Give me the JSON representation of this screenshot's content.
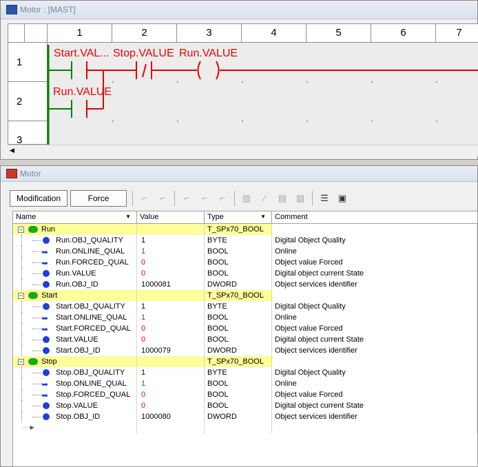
{
  "ladder": {
    "title": "Motor : [MAST]",
    "columns": [
      "1",
      "2",
      "3",
      "4",
      "5",
      "6",
      "7"
    ],
    "rows": [
      "1",
      "2",
      "3"
    ],
    "labels": {
      "start": "Start.VAL...",
      "stop": "Stop.VALUE",
      "run_coil": "Run.VALUE",
      "run_seal": "Run.VALUE"
    }
  },
  "varwin": {
    "title": "Motor",
    "toolbar": {
      "modification": "Modification",
      "force": "Force"
    },
    "headers": {
      "name": "Name",
      "value": "Value",
      "type": "Type",
      "comment": "Comment"
    },
    "groups": [
      {
        "name": "Run",
        "type": "T_SPx70_BOOL",
        "items": [
          {
            "name": "Run.OBJ_QUALITY",
            "value": "1",
            "type": "BYTE",
            "comment": "Digital Object Quality",
            "icon": "dot",
            "vcolor": "black"
          },
          {
            "name": "Run.ONLINE_QUAL",
            "value": "1",
            "type": "BOOL",
            "comment": "Online",
            "icon": "arrow",
            "vcolor": "green"
          },
          {
            "name": "Run.FORCED_QUAL",
            "value": "0",
            "type": "BOOL",
            "comment": "Object value Forced",
            "icon": "arrow",
            "vcolor": "red"
          },
          {
            "name": "Run.VALUE",
            "value": "0",
            "type": "BOOL",
            "comment": "Digital object current State",
            "icon": "dot",
            "vcolor": "red"
          },
          {
            "name": "Run.OBJ_ID",
            "value": "1000081",
            "type": "DWORD",
            "comment": "Object services identifier",
            "icon": "dot",
            "vcolor": "black"
          }
        ]
      },
      {
        "name": "Start",
        "type": "T_SPx70_BOOL",
        "items": [
          {
            "name": "Start.OBJ_QUALITY",
            "value": "1",
            "type": "BYTE",
            "comment": "Digital Object Quality",
            "icon": "dot",
            "vcolor": "black"
          },
          {
            "name": "Start.ONLINE_QUAL",
            "value": "1",
            "type": "BOOL",
            "comment": "Online",
            "icon": "arrow",
            "vcolor": "green"
          },
          {
            "name": "Start.FORCED_QUAL",
            "value": "0",
            "type": "BOOL",
            "comment": "Object value Forced",
            "icon": "arrow",
            "vcolor": "red"
          },
          {
            "name": "Start.VALUE",
            "value": "0",
            "type": "BOOL",
            "comment": "Digital object current State",
            "icon": "dot",
            "vcolor": "red"
          },
          {
            "name": "Start.OBJ_ID",
            "value": "1000079",
            "type": "DWORD",
            "comment": "Object services identifier",
            "icon": "dot",
            "vcolor": "black"
          }
        ]
      },
      {
        "name": "Stop",
        "type": "T_SPx70_BOOL",
        "items": [
          {
            "name": "Stop.OBJ_QUALITY",
            "value": "1",
            "type": "BYTE",
            "comment": "Digital Object Quality",
            "icon": "dot",
            "vcolor": "black"
          },
          {
            "name": "Stop.ONLINE_QUAL",
            "value": "1",
            "type": "BOOL",
            "comment": "Online",
            "icon": "arrow",
            "vcolor": "green"
          },
          {
            "name": "Stop.FORCED_QUAL",
            "value": "0",
            "type": "BOOL",
            "comment": "Object value Forced",
            "icon": "arrow",
            "vcolor": "red"
          },
          {
            "name": "Stop.VALUE",
            "value": "0",
            "type": "BOOL",
            "comment": "Digital object current State",
            "icon": "dot",
            "vcolor": "red"
          },
          {
            "name": "Stop.OBJ_ID",
            "value": "1000080",
            "type": "DWORD",
            "comment": "Object services identifier",
            "icon": "dot",
            "vcolor": "black"
          }
        ]
      }
    ]
  },
  "colors": {
    "energized": "#e00000",
    "rail": "#008000",
    "highlight": "#fdfd9a",
    "bool_true": "#008000",
    "bool_false": "#e00000"
  }
}
